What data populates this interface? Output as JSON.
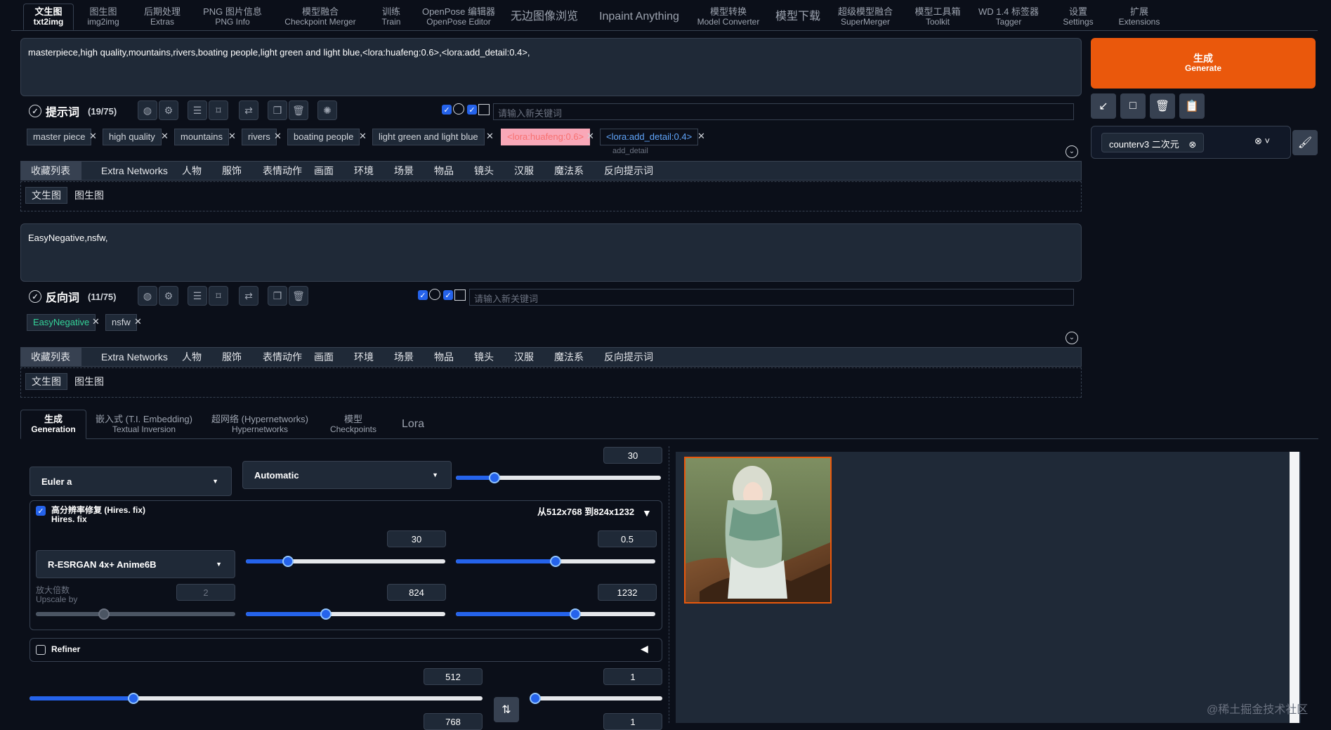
{
  "top_tabs": [
    {
      "label": "文生图",
      "sub": "txt2img"
    },
    {
      "label": "图生图",
      "sub": "img2img"
    },
    {
      "label": "后期处理",
      "sub": "Extras"
    },
    {
      "label": "PNG 图片信息",
      "sub": "PNG Info"
    },
    {
      "label": "模型融合",
      "sub": "Checkpoint Merger"
    },
    {
      "label": "训练",
      "sub": "Train"
    },
    {
      "label": "OpenPose 编辑器",
      "sub": "OpenPose Editor"
    },
    {
      "label": "无边图像浏览",
      "sub": ""
    },
    {
      "label": "Inpaint Anything",
      "sub": ""
    },
    {
      "label": "模型转换",
      "sub": "Model Converter"
    },
    {
      "label": "模型下载",
      "sub": ""
    },
    {
      "label": "超级模型融合",
      "sub": "SuperMerger"
    },
    {
      "label": "模型工具箱",
      "sub": "Toolkit"
    },
    {
      "label": "WD 1.4 标签器",
      "sub": "Tagger"
    },
    {
      "label": "设置",
      "sub": "Settings"
    },
    {
      "label": "扩展",
      "sub": "Extensions"
    }
  ],
  "prompt": {
    "text": "masterpiece,high quality,mountains,rivers,boating people,light green and light blue,<lora:huafeng:0.6>,<lora:add_detail:0.4>,",
    "title": "提示词",
    "count": "(19/75)",
    "keyword_placeholder": "请输入新关键词",
    "tags": [
      "master piece",
      "high quality",
      "mountains",
      "rivers",
      "boating people",
      "light green and light blue",
      "<lora:huafeng:0.6>",
      "<lora:add_detail:0.4>"
    ],
    "lora_sub": "add_detail"
  },
  "negative": {
    "text": "EasyNegative,nsfw,",
    "title": "反向词",
    "count": "(11/75)",
    "keyword_placeholder": "请输入新关键词",
    "tags": [
      "EasyNegative",
      "nsfw"
    ]
  },
  "categories": [
    "收藏列表",
    "Extra Networks",
    "人物",
    "服饰",
    "表情动作",
    "画面",
    "环境",
    "场景",
    "物品",
    "镜头",
    "汉服",
    "魔法系",
    "反向提示词"
  ],
  "subcategories": [
    "文生图",
    "图生图"
  ],
  "generate": {
    "label": "生成",
    "sub": "Generate"
  },
  "style": {
    "selected": "counterv3 二次元"
  },
  "bottom_tabs": [
    {
      "label": "生成",
      "sub": "Generation"
    },
    {
      "label": "嵌入式 (T.I. Embedding)",
      "sub": "Textual Inversion"
    },
    {
      "label": "超网络 (Hypernetworks)",
      "sub": "Hypernetworks"
    },
    {
      "label": "模型",
      "sub": "Checkpoints"
    },
    {
      "label": "Lora",
      "sub": ""
    }
  ],
  "generation": {
    "sampler": "Euler a",
    "schedule": "Automatic",
    "steps": "30",
    "steps_fraction": 0.19,
    "hires": {
      "label": "高分辨率修复 (Hires. fix)",
      "sub": "Hires. fix",
      "enabled": true,
      "summary": "从512x768 到824x1232",
      "upscaler": "R-ESRGAN 4x+ Anime6B",
      "hires_steps": "30",
      "hires_steps_fraction": 0.21,
      "denoise": "0.5",
      "denoise_fraction": 0.5,
      "upscale_label": "放大倍数",
      "upscale_sub": "Upscale by",
      "upscale_by": "2",
      "upscale_fraction": 0.34,
      "width": "824",
      "width_fraction": 0.4,
      "height": "1232",
      "height_fraction": 0.6
    },
    "refiner": "Refiner",
    "width": "512",
    "width_fraction": 0.23,
    "batch_count": "1",
    "batch_count_fraction": 0.0,
    "height": "768",
    "batch_size": "1"
  },
  "watermark": "@稀土掘金技术社区",
  "colors": {
    "accent": "#2563eb",
    "generate": "#ea580c",
    "background": "#0b0f19",
    "panel": "#1f2937",
    "border": "#374151"
  }
}
